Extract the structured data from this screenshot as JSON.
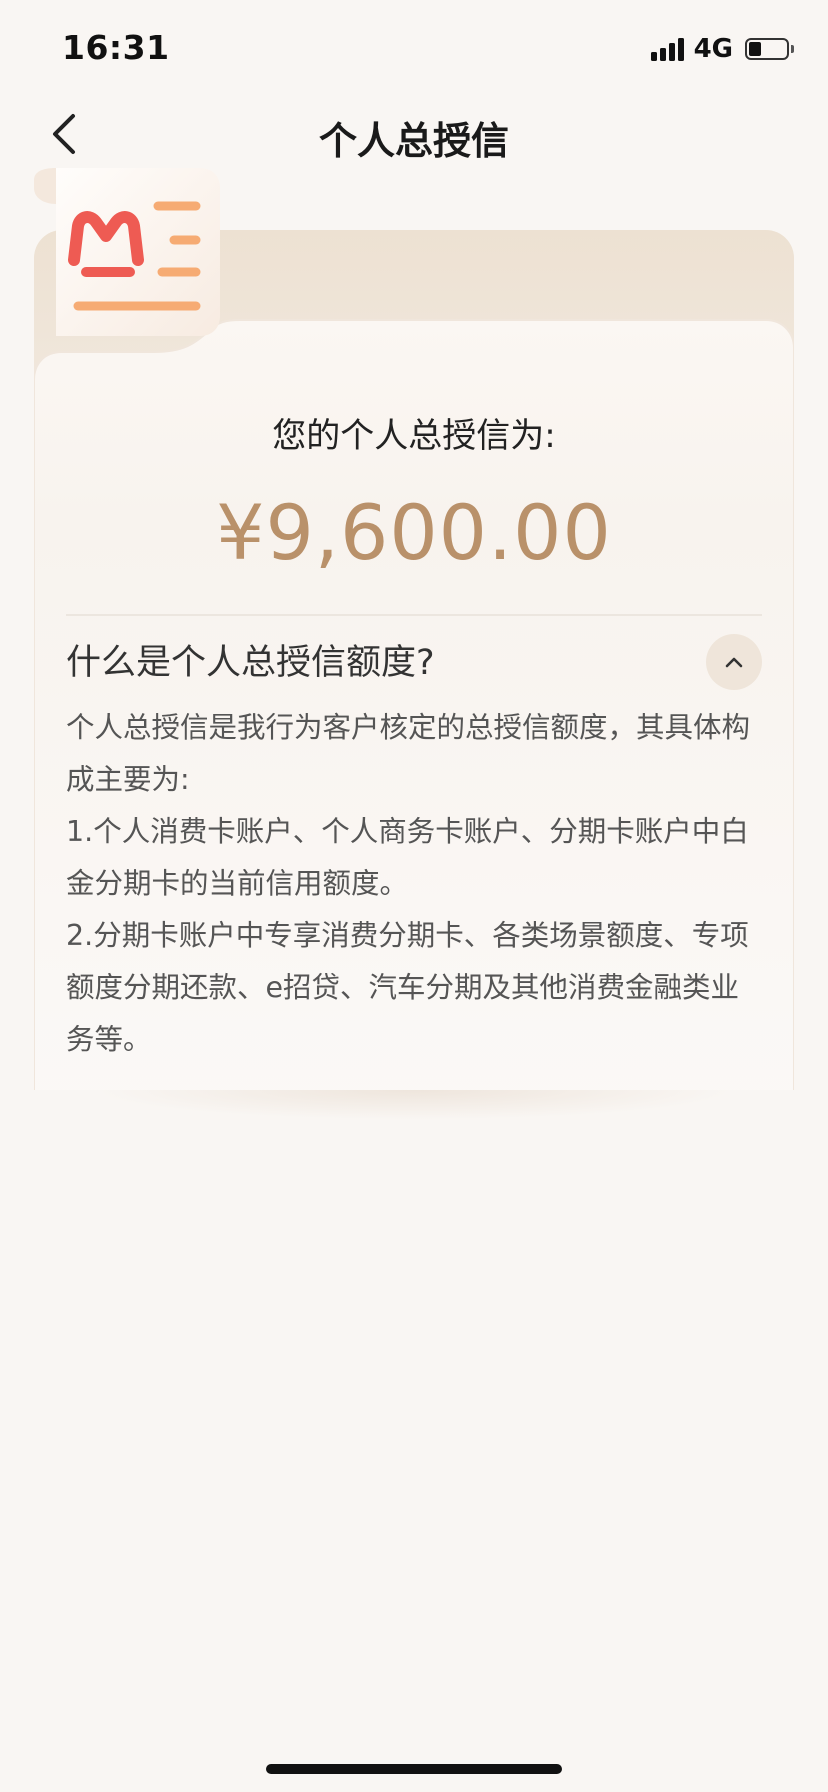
{
  "status_bar": {
    "time": "16:31",
    "network": "4G",
    "battery_level": 0.35
  },
  "nav": {
    "title": "个人总授信",
    "back_icon": "chevron-left-icon"
  },
  "card": {
    "logo_icon": "bank-receipt-logo-icon",
    "title": "您的个人总授信为:",
    "amount": "¥9,600.00",
    "colors": {
      "amount": "#b9916a",
      "logo": "#e8574e",
      "logo_lines": "#f4a261"
    }
  },
  "faq": {
    "question": "什么是个人总授信额度?",
    "expanded": true,
    "toggle_icon": "chevron-up-icon",
    "answer": [
      "个人总授信是我行为客户核定的总授信额度，其具体构成主要为:",
      "1.个人消费卡账户、个人商务卡账户、分期卡账户中白金分期卡的当前信用额度。",
      "2.分期卡账户中专享消费分期卡、各类场景额度、专项额度分期还款、e招贷、汽车分期及其他消费金融类业务等。"
    ]
  }
}
